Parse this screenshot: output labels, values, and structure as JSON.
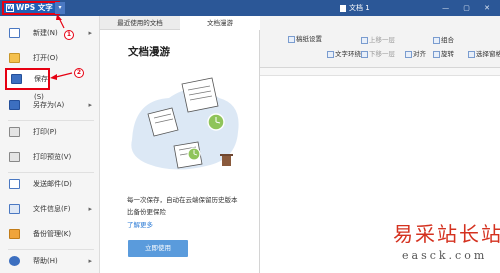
{
  "titlebar": {
    "app_button_label": "WPS 文字",
    "document_tab": "文档 1"
  },
  "ribbon": {
    "items": [
      "稿纸设置",
      "文字环绕",
      "上移一层",
      "下移一层",
      "对齐",
      "组合",
      "旋转",
      "选择窗格"
    ]
  },
  "file_menu": {
    "items": [
      {
        "label": "新建(N)",
        "has_submenu": true
      },
      {
        "label": "打开(O)",
        "has_submenu": false
      },
      {
        "label": "保存(S)",
        "has_submenu": false
      },
      {
        "label": "另存为(A)",
        "has_submenu": true
      },
      {
        "label": "打印(P)",
        "has_submenu": false
      },
      {
        "label": "打印预览(V)",
        "has_submenu": false
      },
      {
        "label": "发送邮件(D)",
        "has_submenu": false
      },
      {
        "label": "文件信息(F)",
        "has_submenu": true
      },
      {
        "label": "备份管理(K)",
        "has_submenu": false
      },
      {
        "label": "帮助(H)",
        "has_submenu": true
      }
    ]
  },
  "panel": {
    "tabs": [
      "最近使用的文档",
      "文档漫游"
    ],
    "active_tab": "文档漫游",
    "title": "文档漫游",
    "description": "每一次保存，自动在云端保留历史版本比备份更保险",
    "description_line1": "每一次保存，自动在云端保留历史版本",
    "description_line2": "比备份更保险",
    "learn_more": "了解更多",
    "use_button": "立即使用"
  },
  "callouts": [
    "1",
    "2"
  ],
  "watermark": {
    "cn": "易采站长站",
    "en": "easck.com"
  },
  "colors": {
    "titlebar": "#2b5797",
    "highlight": "#e60012",
    "button": "#5a9bdc",
    "link": "#2b7bd6"
  }
}
